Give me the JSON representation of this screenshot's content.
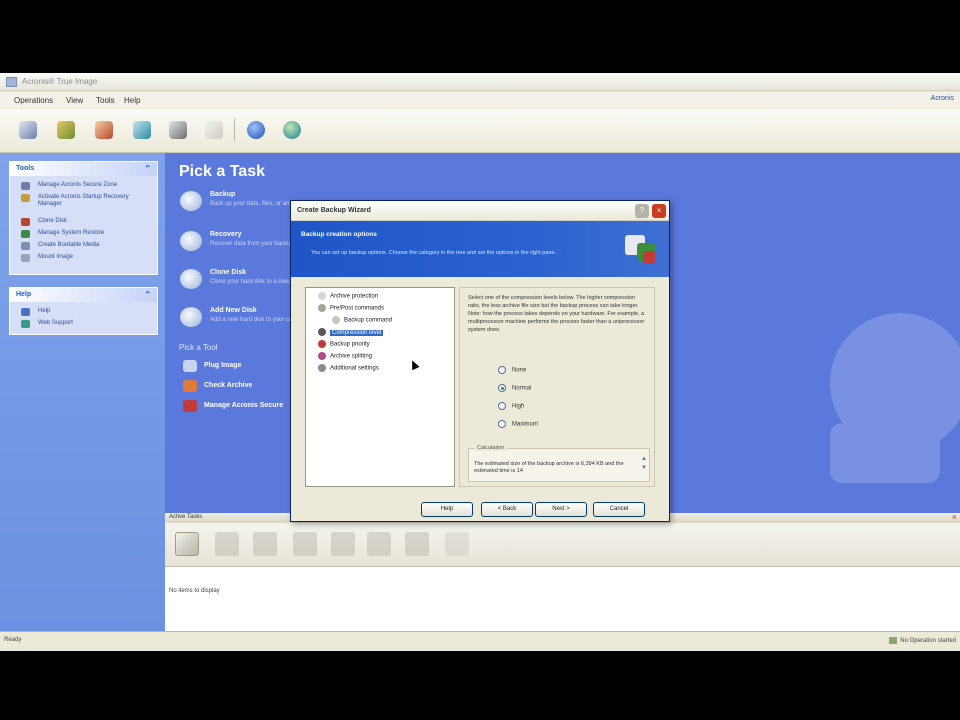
{
  "window": {
    "title": "Acronis® True Image",
    "help_link": "Acronis"
  },
  "menu": [
    "Operations",
    "View",
    "Tools",
    "Help"
  ],
  "toolbar": {
    "icons": [
      "backup-icon",
      "recovery-icon",
      "clone-disk-icon",
      "add-disk-icon",
      "manage-backup-location-icon",
      "blank-toolbar-icon",
      "help-icon",
      "acronis-web-icon"
    ]
  },
  "left_panel": {
    "tools": {
      "title": "Tools",
      "items": [
        "Manage Acronis Secure Zone",
        "Activate Acronis Startup Recovery Manager",
        "Clone Disk",
        "Manage System Restore",
        "Create Bootable Media",
        "Mount Image"
      ]
    },
    "help": {
      "title": "Help",
      "items": [
        "Help",
        "Web Support"
      ]
    }
  },
  "main": {
    "title": "Pick a Task",
    "tasks": [
      {
        "title": "Backup",
        "desc": "Back up your data, files, or an entire partition"
      },
      {
        "title": "Recovery",
        "desc": "Recover data from your backup archive"
      },
      {
        "title": "Clone Disk",
        "desc": "Clone your hard disk to a new disk"
      },
      {
        "title": "Add New Disk",
        "desc": "Add a new hard disk to your computer"
      }
    ],
    "sub_title": "Pick a Tool",
    "sub_items": [
      "Plug Image",
      "Check Archive",
      "Manage Acronis Secure"
    ]
  },
  "active_tasks": {
    "title": "Active Tasks",
    "empty_text": "No items to display"
  },
  "status_bar": {
    "left": "Ready",
    "right": "No Operation started"
  },
  "dialog": {
    "title": "Create Backup Wizard",
    "banner_title": "Backup creation options",
    "banner_desc": "You can set up backup options. Choose the category in the tree and set the options in the right pane.",
    "tree": [
      {
        "label": "Archive protection",
        "level": 1
      },
      {
        "label": "Pre/Post commands",
        "level": 1
      },
      {
        "label": "Backup command",
        "level": 2
      },
      {
        "label": "Compression level",
        "level": 1,
        "selected": true
      },
      {
        "label": "Backup priority",
        "level": 1
      },
      {
        "label": "Archive splitting",
        "level": 1
      },
      {
        "label": "Additional settings",
        "level": 1
      }
    ],
    "description": "Select one of the compression levels below. The higher compression ratio, the less archive file size but the backup process can take longer. Note: how the process takes depends on your hardware. For example, a multiprocessor machine performs the process faster than a uniprocessor system does.",
    "options": [
      "None",
      "Normal",
      "High",
      "Maximum"
    ],
    "selected_option": "Normal",
    "calc_label": "Calculation",
    "calc_text": "The estimated size of the backup archive is 6,394 KB and the estimated time is 14",
    "buttons": [
      "Help",
      "< Back",
      "Next >",
      "Cancel"
    ]
  },
  "colors": {
    "main_blue": "#5b79dc",
    "panel_blue": "#7fa2ea",
    "banner_blue": "#1f55c7",
    "close_red": "#cc3b22"
  }
}
